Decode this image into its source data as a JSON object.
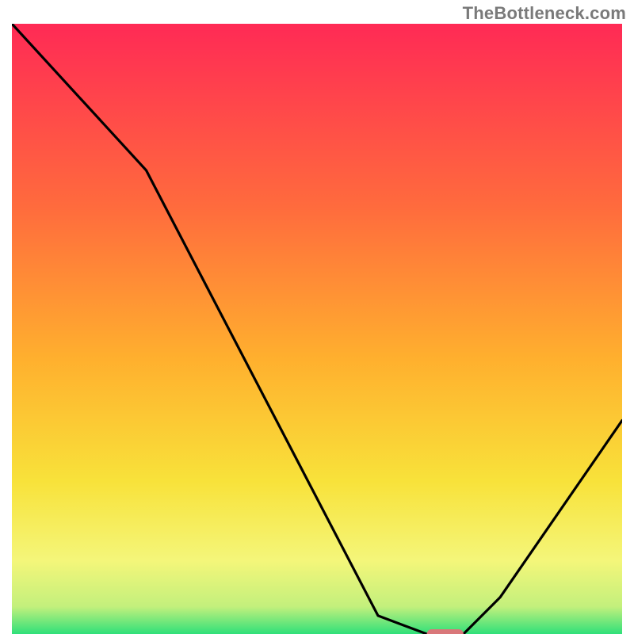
{
  "watermark": "TheBottleneck.com",
  "chart_data": {
    "type": "line",
    "title": "",
    "xlabel": "",
    "ylabel": "",
    "xlim": [
      0,
      100
    ],
    "ylim": [
      0,
      100
    ],
    "grid": false,
    "axes_visible": false,
    "background_gradient": {
      "stops": [
        {
          "offset": 0.0,
          "color": "#ff2a55"
        },
        {
          "offset": 0.3,
          "color": "#ff6b3d"
        },
        {
          "offset": 0.55,
          "color": "#ffb02e"
        },
        {
          "offset": 0.75,
          "color": "#f8e23a"
        },
        {
          "offset": 0.88,
          "color": "#f4f67a"
        },
        {
          "offset": 0.955,
          "color": "#c3f07c"
        },
        {
          "offset": 1.0,
          "color": "#2fe07a"
        }
      ]
    },
    "series": [
      {
        "name": "bottleneck-curve",
        "x": [
          0,
          11,
          22,
          60,
          68,
          74,
          80,
          100
        ],
        "y": [
          100,
          88,
          76,
          3,
          0,
          0,
          6,
          35
        ]
      }
    ],
    "marker": {
      "name": "highlight-segment",
      "x_range": [
        68,
        74
      ],
      "y": 0,
      "color": "#d9777a"
    }
  }
}
